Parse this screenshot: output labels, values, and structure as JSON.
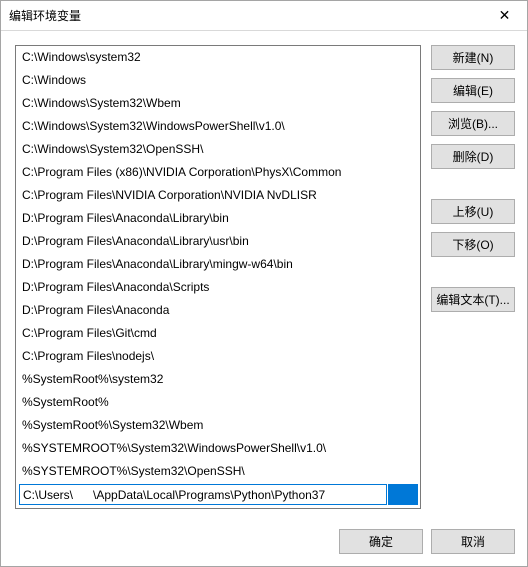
{
  "window": {
    "title": "编辑环境变量",
    "close_glyph": "✕"
  },
  "paths": [
    "C:\\Windows\\system32",
    "C:\\Windows",
    "C:\\Windows\\System32\\Wbem",
    "C:\\Windows\\System32\\WindowsPowerShell\\v1.0\\",
    "C:\\Windows\\System32\\OpenSSH\\",
    "C:\\Program Files (x86)\\NVIDIA Corporation\\PhysX\\Common",
    "C:\\Program Files\\NVIDIA Corporation\\NVIDIA NvDLISR",
    "D:\\Program Files\\Anaconda\\Library\\bin",
    "D:\\Program Files\\Anaconda\\Library\\usr\\bin",
    "D:\\Program Files\\Anaconda\\Library\\mingw-w64\\bin",
    "D:\\Program Files\\Anaconda\\Scripts",
    "D:\\Program Files\\Anaconda",
    "C:\\Program Files\\Git\\cmd",
    "C:\\Program Files\\nodejs\\",
    "%SystemRoot%\\system32",
    "%SystemRoot%",
    "%SystemRoot%\\System32\\Wbem",
    "%SYSTEMROOT%\\System32\\WindowsPowerShell\\v1.0\\",
    "%SYSTEMROOT%\\System32\\OpenSSH\\"
  ],
  "editing_entry": {
    "prefix": "C:\\Users\\",
    "suffix": "\\AppData\\Local\\Programs\\Python\\Python37"
  },
  "buttons": {
    "new": "新建(N)",
    "edit": "编辑(E)",
    "browse": "浏览(B)...",
    "delete": "删除(D)",
    "move_up": "上移(U)",
    "move_down": "下移(O)",
    "edit_text": "编辑文本(T)...",
    "ok": "确定",
    "cancel": "取消"
  }
}
